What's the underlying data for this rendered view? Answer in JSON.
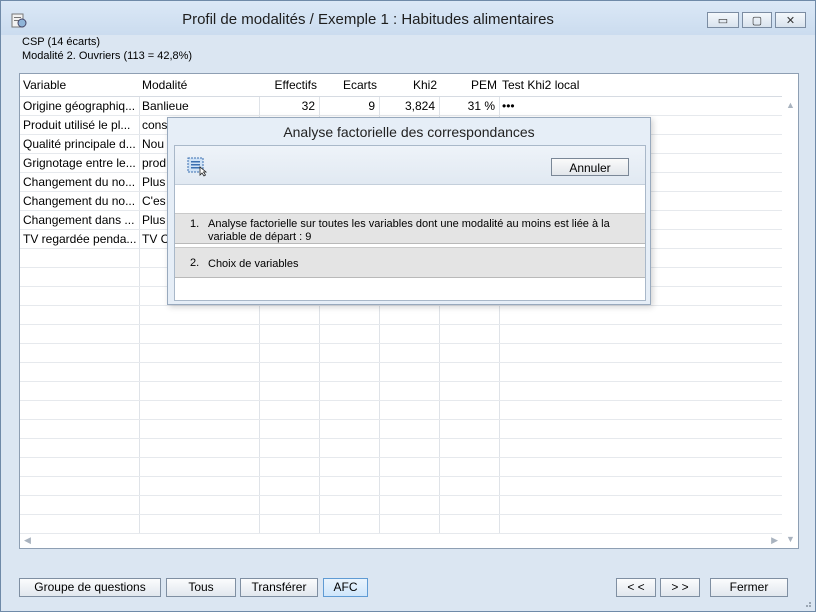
{
  "window": {
    "title": "Profil de modalités / Exemple 1 : Habitudes alimentaires",
    "icons": {
      "app": "app-icon",
      "minimize": "minimize-icon",
      "maximize": "maximize-icon",
      "close": "close-icon"
    },
    "minimize_glyph": "▭",
    "maximize_glyph": "▢",
    "close_glyph": "✕"
  },
  "info": {
    "line1": "CSP (14 écarts)",
    "line2": "Modalité 2. Ouvriers (113 = 42,8%)"
  },
  "grid": {
    "columns": [
      "Variable",
      "Modalité",
      "Effectifs",
      "Ecarts",
      "Khi2",
      "PEM",
      "Test Khi2 local"
    ],
    "rows": [
      {
        "variable": "Origine géographiq...",
        "modalite": "Banlieue",
        "effectifs": "32",
        "ecarts": "9",
        "khi2": "3,824",
        "pem": "31 %",
        "test": "•••"
      },
      {
        "variable": "Produit utilisé le pl...",
        "modalite": "cons",
        "effectifs": "",
        "ecarts": "",
        "khi2": "",
        "pem": "",
        "test": ""
      },
      {
        "variable": "Qualité principale d...",
        "modalite": "Nou",
        "effectifs": "",
        "ecarts": "",
        "khi2": "",
        "pem": "",
        "test": ""
      },
      {
        "variable": "Grignotage entre le...",
        "modalite": "prod",
        "effectifs": "",
        "ecarts": "",
        "khi2": "",
        "pem": "",
        "test": ""
      },
      {
        "variable": "Changement du no...",
        "modalite": "Plus",
        "effectifs": "",
        "ecarts": "",
        "khi2": "",
        "pem": "",
        "test": ""
      },
      {
        "variable": "Changement du no...",
        "modalite": "C'es",
        "effectifs": "",
        "ecarts": "",
        "khi2": "",
        "pem": "",
        "test": ""
      },
      {
        "variable": "Changement dans ...",
        "modalite": "Plus",
        "effectifs": "",
        "ecarts": "",
        "khi2": "",
        "pem": "",
        "test": ""
      },
      {
        "variable": "TV regardée penda...",
        "modalite": "TV C",
        "effectifs": "",
        "ecarts": "",
        "khi2": "",
        "pem": "",
        "test": ""
      }
    ]
  },
  "dialog": {
    "title": "Analyse factorielle des correspondances",
    "cancel_label": "Annuler",
    "icon": "select-list-icon",
    "options": [
      {
        "number": "1.",
        "text": "Analyse factorielle sur toutes les variables dont une modalité au moins est liée à la variable de départ : 9"
      },
      {
        "number": "2.",
        "text": "Choix de variables"
      }
    ]
  },
  "footer": {
    "groupe": "Groupe de questions",
    "tous": "Tous",
    "transferer": "Transférer",
    "afc": "AFC",
    "prev": "< <",
    "next": "> >",
    "fermer": "Fermer"
  },
  "colors": {
    "accent": "#5f9bd4",
    "window_bg": "#dbe6f2"
  }
}
